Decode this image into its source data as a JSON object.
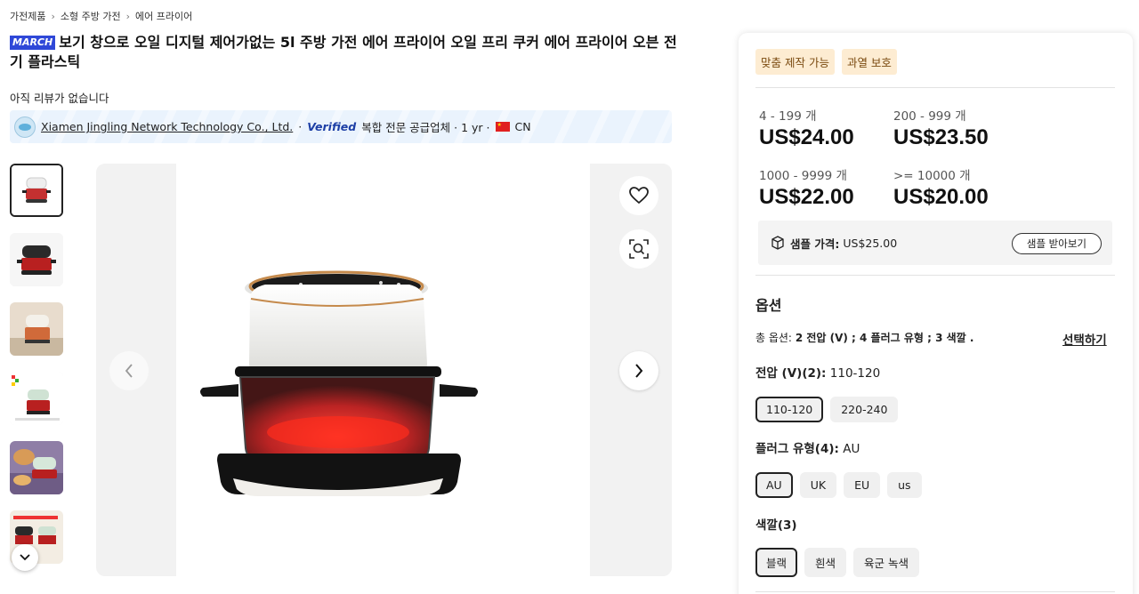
{
  "breadcrumb": [
    "가전제품",
    "소형 주방 가전",
    "에어 프라이어"
  ],
  "product": {
    "badge": "MARCH",
    "title": "보기 창으로 오일 디지털 제어가없는 5l 주방 가전 에어 프라이어 오일 프리 쿠커 에어 프라이어 오븐 전기 플라스틱",
    "reviews": "아직 리뷰가 없습니다"
  },
  "supplier": {
    "name": "Xiamen Jingling Network Technology Co., Ltd.",
    "dot1": "·",
    "verified": "Verified",
    "type": "복합 전문 공급업체 · 1 yr ·",
    "country": "CN"
  },
  "gallery": {
    "thumbnail_count": 6,
    "active_thumbnail": 1
  },
  "panel": {
    "tags": [
      "맞춤 제작 가능",
      "과열 보호"
    ],
    "tiers": [
      {
        "range": "4 - 199 개",
        "price": "US$24.00"
      },
      {
        "range": "200 - 999 개",
        "price": "US$23.50"
      },
      {
        "range": "1000 - 9999 개",
        "price": "US$22.00"
      },
      {
        "range": ">= 10000 개",
        "price": "US$20.00"
      }
    ],
    "sample": {
      "label": "샘플 가격:",
      "price": "US$25.00",
      "button": "샘플 받아보기"
    },
    "options": {
      "title": "옵션",
      "summary_prefix": "총 옵션:",
      "summary": "2 전압 (V) ; 4 플러그 유형 ; 3 색깔 .",
      "select_link": "선택하기",
      "voltage": {
        "label": "전압 (V)(2):",
        "value": "110-120",
        "choices": [
          "110-120",
          "220-240"
        ]
      },
      "plug": {
        "label": "플러그 유형(4):",
        "value": "AU",
        "choices": [
          "AU",
          "UK",
          "EU",
          "us"
        ]
      },
      "color": {
        "label": "색깔(3)",
        "value": "",
        "choices": [
          "블랙",
          "흰색",
          "육군 녹색"
        ]
      }
    }
  },
  "colors": {
    "accent": "#2f48d8",
    "tag_bg": "#fdecd2",
    "verified": "#1d3fa6"
  }
}
